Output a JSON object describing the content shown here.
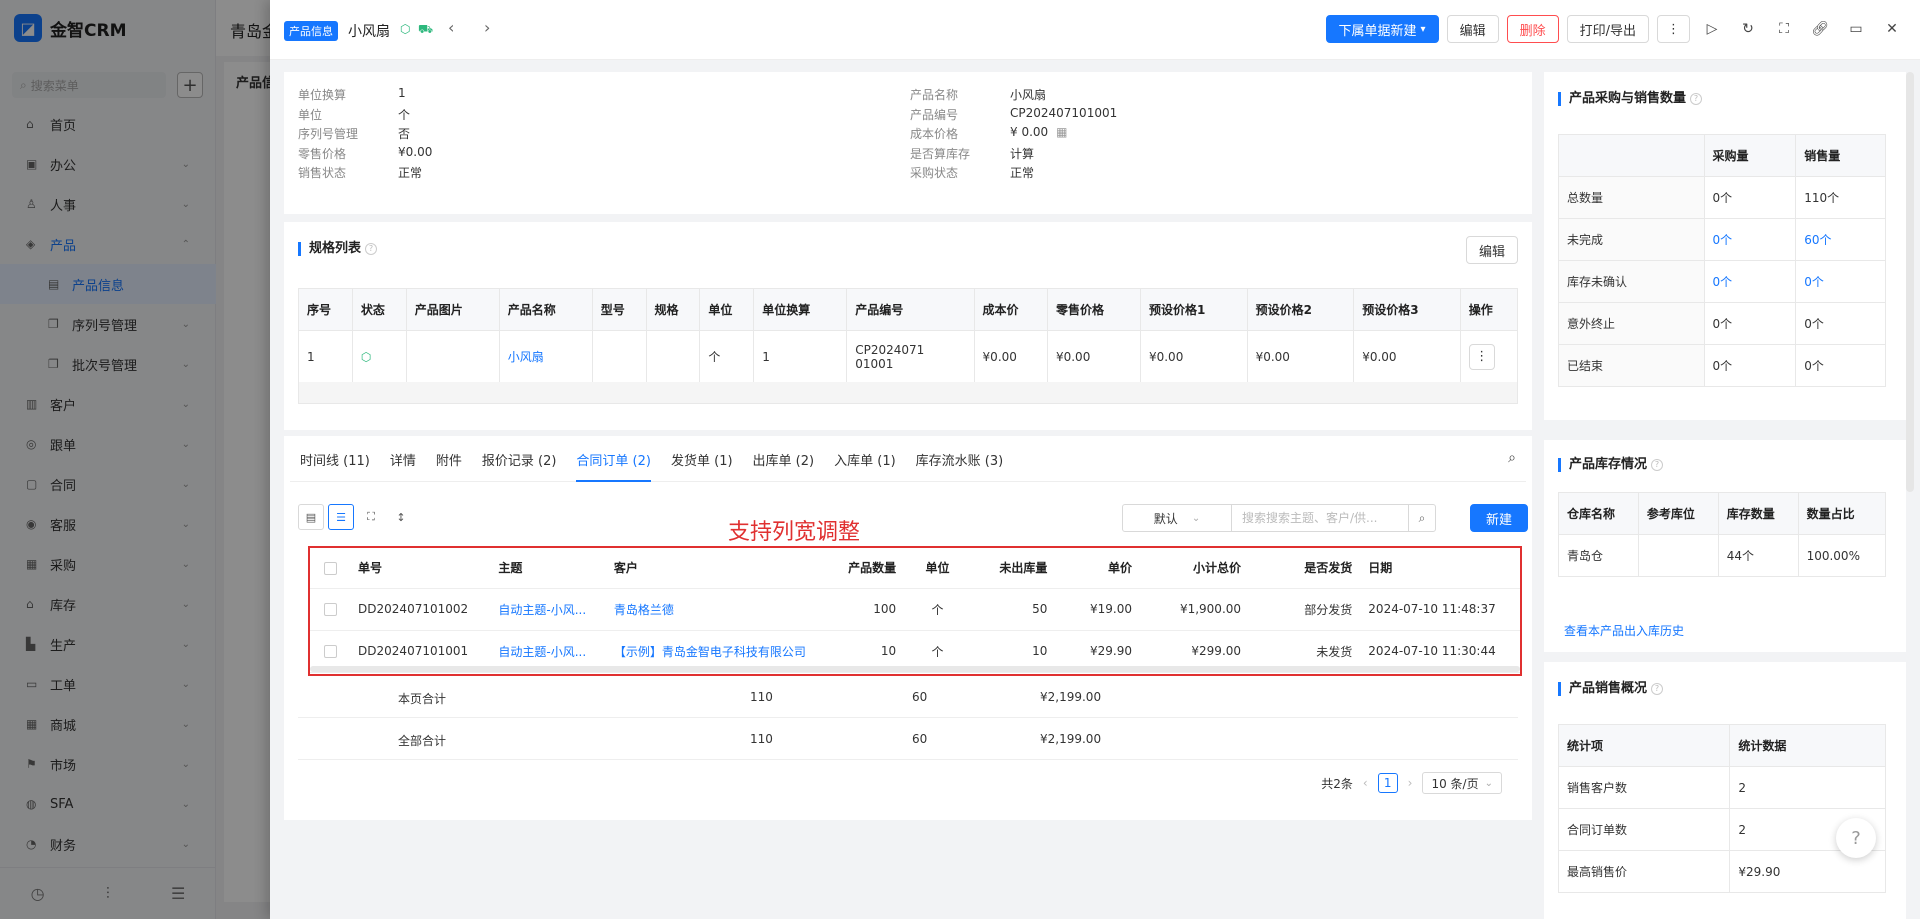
{
  "app": {
    "name": "金智CRM",
    "search_placeholder": "搜索菜单",
    "add": "+"
  },
  "nav": [
    {
      "label": "首页",
      "icon": "home-icon",
      "glyph": "⌂"
    },
    {
      "label": "办公",
      "icon": "office-icon",
      "glyph": "▣",
      "chev": "⌄"
    },
    {
      "label": "人事",
      "icon": "person-icon",
      "glyph": "♙",
      "chev": "⌄"
    },
    {
      "label": "产品",
      "icon": "box-icon",
      "glyph": "◈",
      "chev": "⌃"
    },
    {
      "label": "产品信息",
      "icon": "doc-icon",
      "glyph": "▤"
    },
    {
      "label": "序列号管理",
      "icon": "copy-icon",
      "glyph": "❐",
      "chev": "⌄"
    },
    {
      "label": "批次号管理",
      "icon": "copy-icon",
      "glyph": "❐",
      "chev": "⌄"
    },
    {
      "label": "客户",
      "icon": "chart-icon",
      "glyph": "▥",
      "chev": "⌄"
    },
    {
      "label": "跟单",
      "icon": "flow-icon",
      "glyph": "◎",
      "chev": "⌄"
    },
    {
      "label": "合同",
      "icon": "contract-icon",
      "glyph": "▢",
      "chev": "⌄"
    },
    {
      "label": "客服",
      "icon": "service-icon",
      "glyph": "◉",
      "chev": "⌄"
    },
    {
      "label": "采购",
      "icon": "cart-icon",
      "glyph": "▦",
      "chev": "⌄"
    },
    {
      "label": "库存",
      "icon": "warehouse-icon",
      "glyph": "⌂",
      "chev": "⌄"
    },
    {
      "label": "生产",
      "icon": "factory-icon",
      "glyph": "▙",
      "chev": "⌄"
    },
    {
      "label": "工单",
      "icon": "ticket-icon",
      "glyph": "▭",
      "chev": "⌄"
    },
    {
      "label": "商城",
      "icon": "shop-icon",
      "glyph": "▦",
      "chev": "⌄"
    },
    {
      "label": "市场",
      "icon": "flag-icon",
      "glyph": "⚑",
      "chev": "⌄"
    },
    {
      "label": "SFA",
      "icon": "sfa-icon",
      "glyph": "◍",
      "chev": "⌄"
    },
    {
      "label": "财务",
      "icon": "finance-icon",
      "glyph": "◔",
      "chev": "⌄"
    }
  ],
  "bg": {
    "title": "青岛金",
    "card_title": "产品信"
  },
  "drawer": {
    "tag": "产品信息",
    "title": "小风扇",
    "buttons": {
      "new_sub": "下属单据新建",
      "edit": "编辑",
      "delete": "删除",
      "print": "打印/导出"
    }
  },
  "info_left": [
    {
      "k": "单位换算",
      "v": "1"
    },
    {
      "k": "单位",
      "v": "个"
    },
    {
      "k": "序列号管理",
      "v": "否"
    },
    {
      "k": "零售价格",
      "v": "¥0.00"
    },
    {
      "k": "销售状态",
      "v": "正常"
    }
  ],
  "info_right": [
    {
      "k": "产品名称",
      "v": "小风扇"
    },
    {
      "k": "产品编号",
      "v": "CP202407101001"
    },
    {
      "k": "成本价格",
      "v": "¥ 0.00"
    },
    {
      "k": "是否算库存",
      "v": "计算"
    },
    {
      "k": "采购状态",
      "v": "正常"
    }
  ],
  "spec": {
    "title": "规格列表",
    "edit": "编辑",
    "headers": [
      "序号",
      "状态",
      "产品图片",
      "产品名称",
      "型号",
      "规格",
      "单位",
      "单位换算",
      "产品编号",
      "成本价",
      "零售价格",
      "预设价格1",
      "预设价格2",
      "预设价格3",
      "操作"
    ],
    "row": {
      "no": "1",
      "name": "小风扇",
      "unit": "个",
      "conv": "1",
      "code1": "CP2024071",
      "code2": "01001",
      "cost": "¥0.00",
      "retail": "¥0.00",
      "p1": "¥0.00",
      "p2": "¥0.00",
      "p3": "¥0.00",
      "op": "⋮"
    }
  },
  "tabs": [
    "时间线 (11)",
    "详情",
    "附件",
    "报价记录 (2)",
    "合同订单 (2)",
    "发货单 (1)",
    "出库单 (2)",
    "入库单 (1)",
    "库存流水账 (3)"
  ],
  "orders": {
    "sort": "默认",
    "search_placeholder": "搜索搜索主题、客户/供...",
    "new": "新建",
    "annotation": "支持列宽调整",
    "headers": [
      "单号",
      "主题",
      "客户",
      "产品数量",
      "单位",
      "未出库量",
      "单价",
      "小计总价",
      "是否发货",
      "日期"
    ],
    "rows": [
      {
        "no": "DD202407101002",
        "subject": "自动主题-小风...",
        "customer": "青岛格兰德",
        "qty": "100",
        "unit": "个",
        "pending": "50",
        "price": "¥19.00",
        "total": "¥1,900.00",
        "shipped": "部分发货",
        "date": "2024-07-10 11:48:37"
      },
      {
        "no": "DD202407101001",
        "subject": "自动主题-小风...",
        "customer": "【示例】青岛金智电子科技有限公司",
        "qty": "10",
        "unit": "个",
        "pending": "10",
        "price": "¥29.90",
        "total": "¥299.00",
        "shipped": "未发货",
        "date": "2024-07-10 11:30:44"
      }
    ],
    "page_sum": {
      "label": "本页合计",
      "qty": "110",
      "pending": "60",
      "total": "¥2,199.00"
    },
    "all_sum": {
      "label": "全部合计",
      "qty": "110",
      "pending": "60",
      "total": "¥2,199.00"
    },
    "pager": {
      "total": "共2条",
      "page": "1",
      "size": "10 条/页"
    }
  },
  "right": {
    "purchase_sales": {
      "title": "产品采购与销售数量",
      "cols": [
        "",
        "采购量",
        "销售量"
      ],
      "rows": [
        [
          "总数量",
          "0个",
          "110个"
        ],
        [
          "未完成",
          "0个",
          "60个"
        ],
        [
          "库存未确认",
          "0个",
          "0个"
        ],
        [
          "意外终止",
          "0个",
          "0个"
        ],
        [
          "已结束",
          "0个",
          "0个"
        ]
      ]
    },
    "stock": {
      "title": "产品库存情况",
      "cols": [
        "仓库名称",
        "参考库位",
        "库存数量",
        "数量占比"
      ],
      "row": [
        "青岛仓",
        "",
        "44个",
        "100.00%"
      ],
      "link": "查看本产品出入库历史"
    },
    "sales": {
      "title": "产品销售概况",
      "cols": [
        "统计项",
        "统计数据"
      ],
      "rows": [
        [
          "销售客户数",
          "2"
        ],
        [
          "合同订单数",
          "2"
        ],
        [
          "最高销售价",
          "¥29.90"
        ]
      ]
    }
  },
  "colors": {
    "primary": "#1677ff",
    "danger": "#ff4d4f",
    "annotation": "#e03030"
  }
}
